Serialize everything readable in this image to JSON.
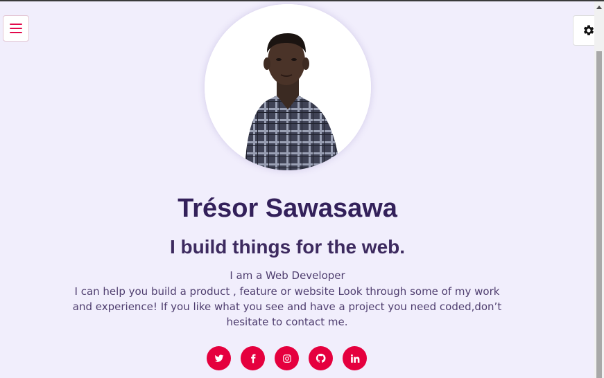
{
  "header": {
    "menu_icon": "hamburger-menu-icon",
    "settings_icon": "gear-icon",
    "accent_color": "#e2094b"
  },
  "profile": {
    "avatar_alt": "Trésor Sawasawa",
    "name": "Trésor Sawasawa",
    "tagline": "I build things for the web.",
    "role": "I am a Web Developer",
    "bio": "I can help you build a product , feature or website Look through some of my work and experience! If you like what you see and have a project you need coded,don’t hesitate to contact me."
  },
  "socials": [
    {
      "icon": "twitter-icon"
    },
    {
      "icon": "facebook-icon"
    },
    {
      "icon": "instagram-icon"
    },
    {
      "icon": "github-icon"
    },
    {
      "icon": "linkedin-icon"
    }
  ],
  "colors": {
    "background": "#f1eefc",
    "heading": "#33205a",
    "social_bg": "#e5003e"
  }
}
